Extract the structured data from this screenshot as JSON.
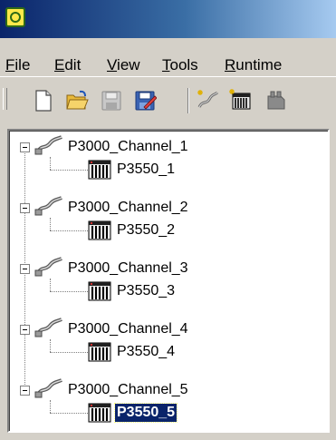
{
  "menu": {
    "items": [
      {
        "first": "F",
        "rest": "ile"
      },
      {
        "first": "E",
        "rest": "dit"
      },
      {
        "first": "V",
        "rest": "iew"
      },
      {
        "first": "T",
        "rest": "ools"
      },
      {
        "first": "R",
        "rest": "untime"
      }
    ]
  },
  "toolbar": {
    "buttons": [
      "new-file-icon",
      "open-folder-icon",
      "save-icon",
      "save-all-icon",
      "add-channel-icon",
      "add-device-icon",
      "add-tag-icon"
    ]
  },
  "tree": {
    "channels": [
      {
        "label": "P3000_Channel_1",
        "device": "P3550_1"
      },
      {
        "label": "P3000_Channel_2",
        "device": "P3550_2"
      },
      {
        "label": "P3000_Channel_3",
        "device": "P3550_3"
      },
      {
        "label": "P3000_Channel_4",
        "device": "P3550_4"
      },
      {
        "label": "P3000_Channel_5",
        "device": "P3550_5"
      }
    ],
    "selected": "P3550_5"
  },
  "colors": {
    "title_active": "#0a246a",
    "selection": "#0a246a",
    "face": "#d4d0c8"
  }
}
